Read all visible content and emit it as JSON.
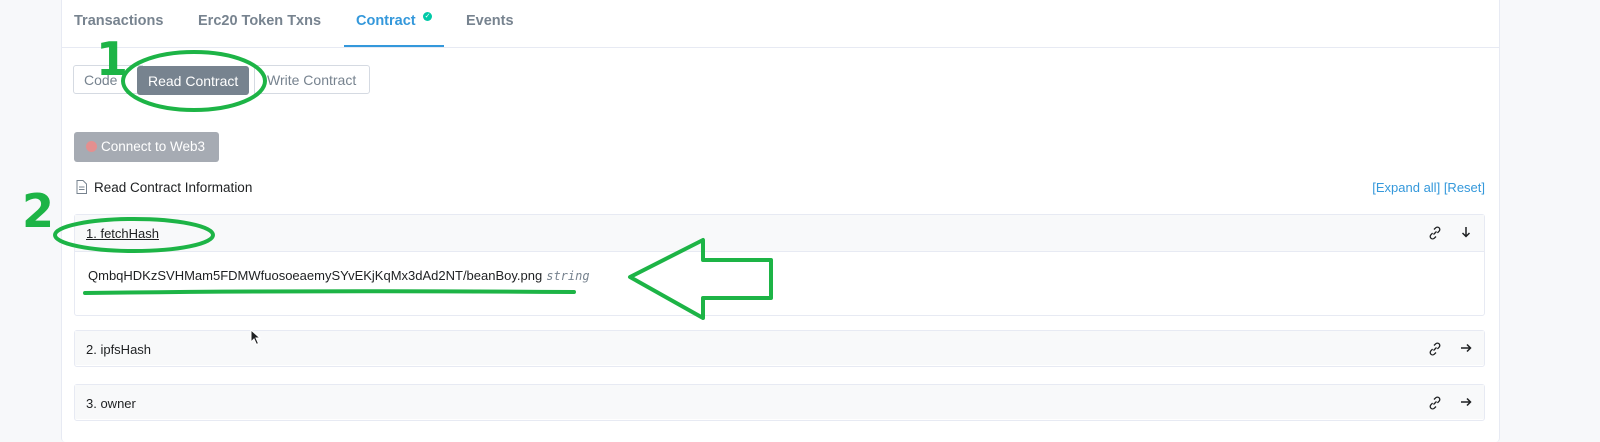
{
  "tabs": [
    {
      "label": "Transactions"
    },
    {
      "label": "Erc20 Token Txns"
    },
    {
      "label": "Contract"
    },
    {
      "label": "Events"
    }
  ],
  "subnav": {
    "code": "Code",
    "read": "Read Contract",
    "write": "Write Contract"
  },
  "web3_button": "Connect to Web3",
  "info": {
    "title": "Read Contract Information",
    "expand_all": "[Expand all]",
    "reset": "[Reset]"
  },
  "functions": [
    {
      "label": "1. fetchHash",
      "value": "QmbqHDKzSVHMam5FDMWfuosoeaemySYvEKjKqMx3dAd2NT/beanBoy.png",
      "type": "string"
    },
    {
      "label": "2. ipfsHash"
    },
    {
      "label": "3. owner"
    }
  ],
  "annotations": {
    "step1": "1",
    "step2": "2",
    "color": "#1db446"
  },
  "colors": {
    "accent": "#3498db",
    "active_button": "#77838f",
    "verified": "#00c9a7"
  }
}
